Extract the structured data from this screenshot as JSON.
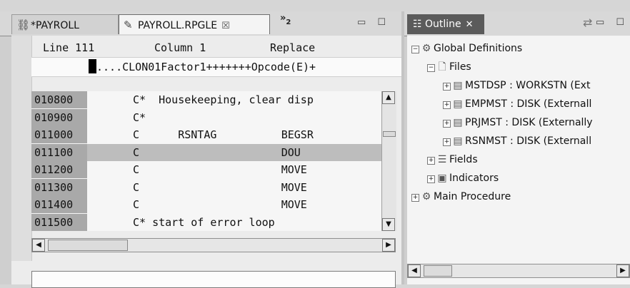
{
  "editor": {
    "tabs": [
      {
        "label": "*PAYROLL",
        "icon": "project-icon"
      },
      {
        "label": "PAYROLL.RPGLE",
        "icon": "pencil-icon",
        "close": "☒"
      }
    ],
    "overflow": {
      "glyph": "»",
      "count": "2"
    },
    "window_buttons": "▭ ☐",
    "status": {
      "line_label": "Line 111",
      "column_label": "Column 1",
      "mode": "Replace"
    },
    "ruler": "....CLON01Factor1+++++++Opcode(E)+",
    "rows": [
      {
        "seq": "010800",
        "spec": "C*",
        "text": "C*  Housekeeping, clear disp"
      },
      {
        "seq": "010900",
        "spec": "C*",
        "text": "C*"
      },
      {
        "seq": "011000",
        "spec": "C",
        "text": "C      RSNTAG          BEGSR"
      },
      {
        "seq": "011100",
        "spec": "C",
        "text": "C                      DOU"
      },
      {
        "seq": "011200",
        "spec": "C",
        "text": "C                      MOVE"
      },
      {
        "seq": "011300",
        "spec": "C",
        "text": "C                      MOVE"
      },
      {
        "seq": "011400",
        "spec": "C",
        "text": "C                      MOVE"
      },
      {
        "seq": "011500",
        "spec": "C*",
        "text": "C* start of error loop"
      }
    ],
    "selected_row_index": 3,
    "command_input": ""
  },
  "outline": {
    "title": "Outline",
    "close": "✕",
    "window_buttons": "▭ ☐",
    "tree": [
      {
        "label": "Global Definitions",
        "toggle": "−",
        "icon": "global-definitions-icon"
      },
      {
        "label": "Files",
        "toggle": "−",
        "icon": "files-icon"
      },
      {
        "label": "MSTDSP : WORKSTN (Ext",
        "toggle": "+",
        "icon": "file-icon"
      },
      {
        "label": "EMPMST : DISK (Externall",
        "toggle": "+",
        "icon": "file-icon"
      },
      {
        "label": "PRJMST : DISK (Externally",
        "toggle": "+",
        "icon": "file-icon"
      },
      {
        "label": "RSNMST : DISK (Externall",
        "toggle": "+",
        "icon": "file-icon"
      },
      {
        "label": "Fields",
        "toggle": "+",
        "icon": "fields-icon"
      },
      {
        "label": "Indicators",
        "toggle": "+",
        "icon": "indicators-icon"
      },
      {
        "label": "Main Procedure",
        "toggle": "+",
        "icon": "main-procedure-icon"
      }
    ]
  },
  "scroll_arrows": {
    "up": "▲",
    "down": "▼",
    "left": "◀",
    "right": "▶"
  }
}
